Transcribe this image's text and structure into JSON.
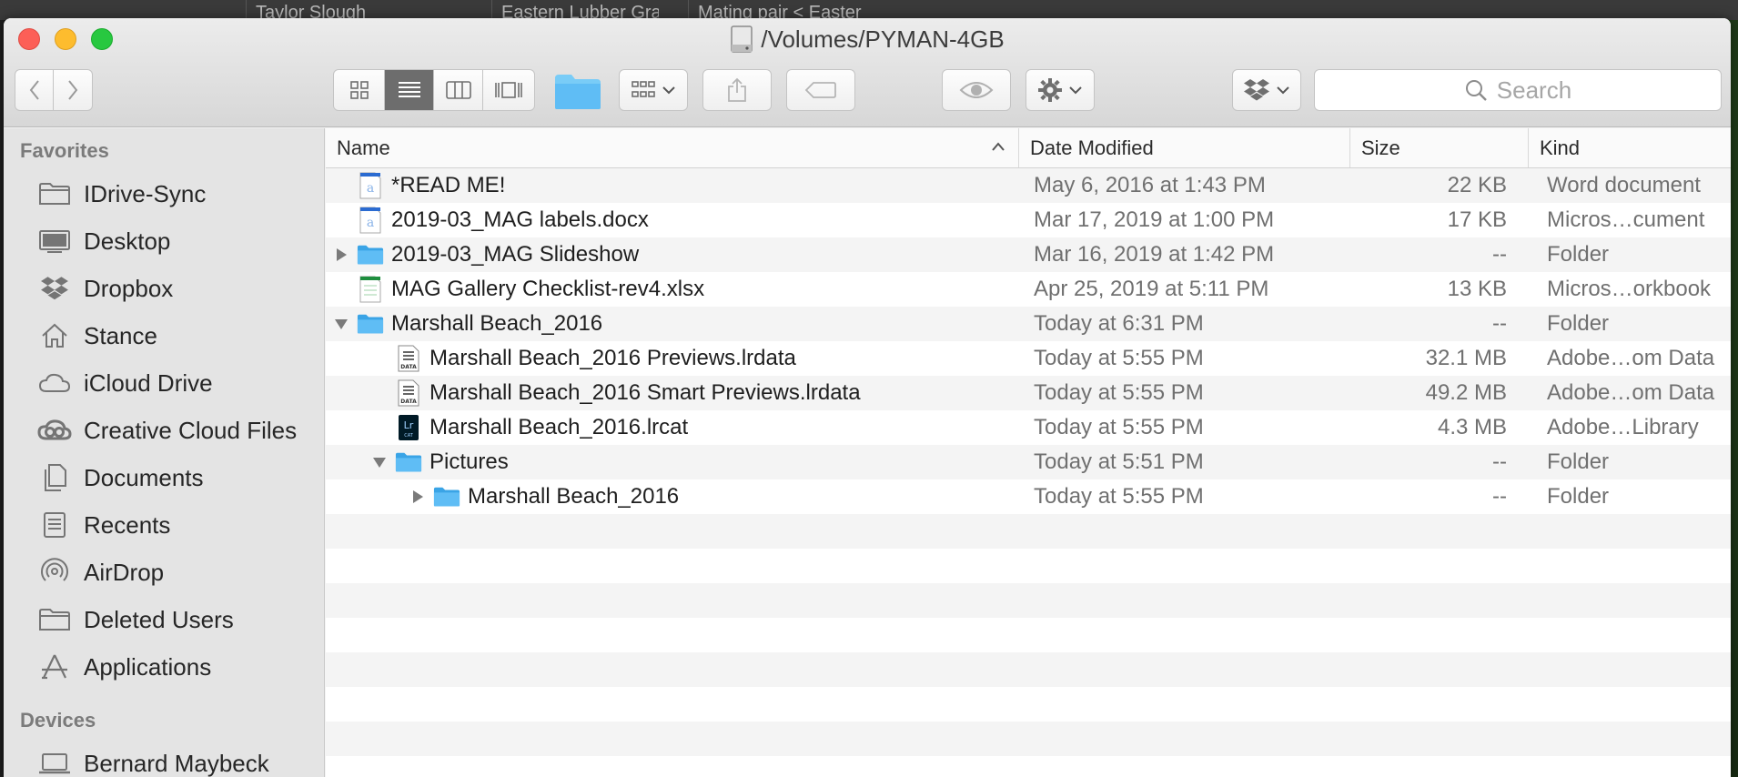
{
  "background": {
    "tabs": [
      "Taylor Slough",
      "Eastern Lubber Gras",
      "Mating pair < Easter"
    ]
  },
  "window": {
    "title": "/Volumes/PYMAN-4GB"
  },
  "toolbar": {
    "search_placeholder": "Search"
  },
  "sidebar": {
    "favorites_header": "Favorites",
    "favorites": [
      {
        "label": "IDrive-Sync",
        "icon": "folder-icon"
      },
      {
        "label": "Desktop",
        "icon": "desktop-icon"
      },
      {
        "label": "Dropbox",
        "icon": "dropbox-icon"
      },
      {
        "label": "Stance",
        "icon": "home-icon"
      },
      {
        "label": "iCloud Drive",
        "icon": "cloud-icon"
      },
      {
        "label": "Creative Cloud Files",
        "icon": "creative-cloud-icon"
      },
      {
        "label": "Documents",
        "icon": "documents-icon"
      },
      {
        "label": "Recents",
        "icon": "recents-icon"
      },
      {
        "label": "AirDrop",
        "icon": "airdrop-icon"
      },
      {
        "label": "Deleted Users",
        "icon": "folder-icon"
      },
      {
        "label": "Applications",
        "icon": "applications-icon"
      }
    ],
    "devices_header": "Devices",
    "devices": [
      {
        "label": "Bernard Maybeck",
        "icon": "laptop-icon"
      }
    ]
  },
  "columns": {
    "name": "Name",
    "date": "Date Modified",
    "size": "Size",
    "kind": "Kind"
  },
  "files": [
    {
      "name": "*READ ME!",
      "date": "May 6, 2016 at 1:43 PM",
      "size": "22 KB",
      "kind": "Word document",
      "indent": 0,
      "disclosure": "",
      "icon": "word-doc-icon"
    },
    {
      "name": "2019-03_MAG labels.docx",
      "date": "Mar 17, 2019 at 1:00 PM",
      "size": "17 KB",
      "kind": "Micros…cument",
      "indent": 0,
      "disclosure": "",
      "icon": "word-doc-icon"
    },
    {
      "name": "2019-03_MAG Slideshow",
      "date": "Mar 16, 2019 at 1:42 PM",
      "size": "--",
      "kind": "Folder",
      "indent": 0,
      "disclosure": "collapsed",
      "icon": "folder-icon"
    },
    {
      "name": "MAG Gallery Checklist-rev4.xlsx",
      "date": "Apr 25, 2019 at 5:11 PM",
      "size": "13 KB",
      "kind": "Micros…orkbook",
      "indent": 0,
      "disclosure": "",
      "icon": "spreadsheet-icon"
    },
    {
      "name": "Marshall Beach_2016",
      "date": "Today at 6:31 PM",
      "size": "--",
      "kind": "Folder",
      "indent": 0,
      "disclosure": "expanded",
      "icon": "folder-icon"
    },
    {
      "name": "Marshall Beach_2016 Previews.lrdata",
      "date": "Today at 5:55 PM",
      "size": "32.1 MB",
      "kind": "Adobe…om Data",
      "indent": 1,
      "disclosure": "",
      "icon": "lrdata-icon"
    },
    {
      "name": "Marshall Beach_2016 Smart Previews.lrdata",
      "date": "Today at 5:55 PM",
      "size": "49.2 MB",
      "kind": "Adobe…om Data",
      "indent": 1,
      "disclosure": "",
      "icon": "lrdata-icon"
    },
    {
      "name": "Marshall Beach_2016.lrcat",
      "date": "Today at 5:55 PM",
      "size": "4.3 MB",
      "kind": "Adobe…Library",
      "indent": 1,
      "disclosure": "",
      "icon": "lrcat-icon"
    },
    {
      "name": "Pictures",
      "date": "Today at 5:51 PM",
      "size": "--",
      "kind": "Folder",
      "indent": 1,
      "disclosure": "expanded",
      "icon": "folder-icon"
    },
    {
      "name": "Marshall Beach_2016",
      "date": "Today at 5:55 PM",
      "size": "--",
      "kind": "Folder",
      "indent": 2,
      "disclosure": "collapsed",
      "icon": "folder-icon"
    }
  ],
  "colors": {
    "folder": "#5fbdf5",
    "folder_dark": "#3aa4e6",
    "selected_segment": "#6d6d6d"
  }
}
